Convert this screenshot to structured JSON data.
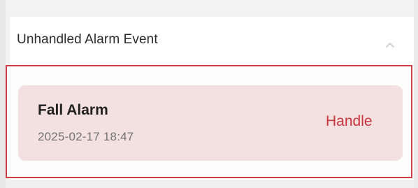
{
  "section": {
    "title": "Unhandled Alarm Event",
    "collapse_icon": "chevron-up-icon"
  },
  "alarm": {
    "title": "Fall Alarm",
    "timestamp": "2025-02-17 18:47",
    "action_label": "Handle",
    "action_color": "#c8343d",
    "card_color": "#f3e1e1",
    "highlight_color": "#cf3c45"
  }
}
